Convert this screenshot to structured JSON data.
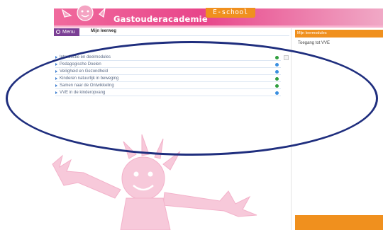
{
  "header": {
    "brand": "Gastouderacademie",
    "product_tab": "E-school"
  },
  "subbar": {
    "menu_label": "Menu",
    "section_title": "Mijn leerweg"
  },
  "modules": [
    {
      "label": "Introductie en deelmodules",
      "status": "done"
    },
    {
      "label": "Pedagogische Doelen",
      "status": "info"
    },
    {
      "label": "Veiligheid en Gezondheid",
      "status": "info"
    },
    {
      "label": "Kinderen natuurlijk in beweging",
      "status": "done"
    },
    {
      "label": "Samen naar de Ontwikkeling",
      "status": "done"
    },
    {
      "label": "VVE in de kinderopvang",
      "status": "info"
    }
  ],
  "sidebar": {
    "title": "Mijn leermodules",
    "text": "Toegang tot VVE"
  },
  "colors": {
    "header_pink": "#e8458a",
    "accent_orange": "#f0901e",
    "annotation_navy": "#1f2e7e",
    "status_green": "#2f9e3e",
    "status_blue": "#3a8fe0"
  },
  "icons": {
    "logo": "sun-child-logo",
    "bullet": "triangle-bullet-icon",
    "status_done": "green-dot-icon",
    "status_info": "blue-info-icon"
  }
}
